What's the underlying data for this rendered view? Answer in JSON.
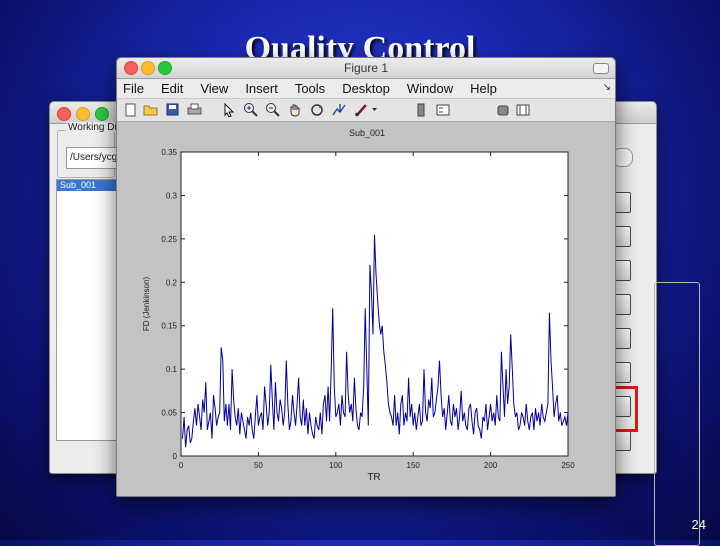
{
  "slide": {
    "title": "Quality Control",
    "page_number": "24"
  },
  "back_window": {
    "working_dir_label": "Working Di",
    "path_value": "/Users/ycg",
    "subjects": [
      "Sub_001"
    ],
    "right_buttons": 8
  },
  "figure": {
    "window_title": "Figure 1",
    "menu": [
      "File",
      "Edit",
      "View",
      "Insert",
      "Tools",
      "Desktop",
      "Window",
      "Help"
    ],
    "toolbar_icons": [
      "new-figure-icon",
      "open-file-icon",
      "save-icon",
      "print-icon",
      "pointer-icon",
      "zoom-in-icon",
      "zoom-out-icon",
      "pan-icon",
      "rotate-icon",
      "data-cursor-icon",
      "brush-icon",
      "colorbar-icon",
      "legend-icon",
      "plot-tools-icon"
    ]
  },
  "chart_data": {
    "type": "line",
    "title": "Sub_001",
    "xlabel": "TR",
    "ylabel": "FD (Jenkinson)",
    "xlim": [
      0,
      250
    ],
    "ylim": [
      0,
      0.35
    ],
    "xticks": [
      0,
      50,
      100,
      150,
      200,
      250
    ],
    "yticks": [
      0,
      0.05,
      0.1,
      0.15,
      0.2,
      0.25,
      0.3,
      0.35
    ],
    "color": "#0000a0",
    "series": [
      {
        "values": [
          0.02,
          0.045,
          0.01,
          0.03,
          0.035,
          0.015,
          0.02,
          0.04,
          0.055,
          0.035,
          0.06,
          0.045,
          0.03,
          0.065,
          0.05,
          0.085,
          0.03,
          0.04,
          0.05,
          0.02,
          0.07,
          0.055,
          0.035,
          0.045,
          0.05,
          0.125,
          0.11,
          0.04,
          0.06,
          0.035,
          0.06,
          0.03,
          0.1,
          0.065,
          0.045,
          0.035,
          0.055,
          0.025,
          0.05,
          0.04,
          0.03,
          0.02,
          0.045,
          0.035,
          0.05,
          0.03,
          0.02,
          0.045,
          0.07,
          0.035,
          0.045,
          0.05,
          0.03,
          0.08,
          0.06,
          0.035,
          0.05,
          0.105,
          0.065,
          0.03,
          0.085,
          0.05,
          0.04,
          0.065,
          0.055,
          0.035,
          0.05,
          0.11,
          0.06,
          0.03,
          0.04,
          0.07,
          0.05,
          0.035,
          0.06,
          0.09,
          0.045,
          0.035,
          0.065,
          0.035,
          0.055,
          0.025,
          0.05,
          0.035,
          0.025,
          0.02,
          0.045,
          0.035,
          0.03,
          0.05,
          0.025,
          0.06,
          0.07,
          0.04,
          0.08,
          0.04,
          0.1,
          0.17,
          0.08,
          0.045,
          0.05,
          0.06,
          0.035,
          0.07,
          0.05,
          0.045,
          0.12,
          0.07,
          0.05,
          0.06,
          0.04,
          0.09,
          0.055,
          0.035,
          0.03,
          0.05,
          0.045,
          0.08,
          0.17,
          0.1,
          0.035,
          0.22,
          0.19,
          0.14,
          0.255,
          0.21,
          0.18,
          0.155,
          0.14,
          0.15,
          0.12,
          0.105,
          0.085,
          0.06,
          0.05,
          0.045,
          0.035,
          0.07,
          0.035,
          0.05,
          0.025,
          0.06,
          0.07,
          0.035,
          0.05,
          0.04,
          0.09,
          0.045,
          0.06,
          0.035,
          0.05,
          0.03,
          0.045,
          0.06,
          0.035,
          0.04,
          0.1,
          0.05,
          0.04,
          0.065,
          0.055,
          0.09,
          0.045,
          0.05,
          0.065,
          0.08,
          0.11,
          0.07,
          0.045,
          0.055,
          0.03,
          0.05,
          0.07,
          0.04,
          0.035,
          0.06,
          0.045,
          0.055,
          0.03,
          0.045,
          0.075,
          0.04,
          0.05,
          0.035,
          0.03,
          0.055,
          0.06,
          0.04,
          0.025,
          0.05,
          0.055,
          0.035,
          0.03,
          0.02,
          0.045,
          0.04,
          0.06,
          0.03,
          0.045,
          0.06,
          0.04,
          0.05,
          0.035,
          0.07,
          0.045,
          0.04,
          0.12,
          0.08,
          0.045,
          0.1,
          0.06,
          0.08,
          0.14,
          0.1,
          0.06,
          0.045,
          0.05,
          0.03,
          0.035,
          0.05,
          0.045,
          0.035,
          0.06,
          0.04,
          0.03,
          0.045,
          0.05,
          0.03,
          0.055,
          0.04,
          0.05,
          0.035,
          0.06,
          0.045,
          0.04,
          0.05,
          0.06,
          0.165,
          0.11,
          0.08,
          0.045,
          0.06,
          0.07,
          0.04,
          0.05,
          0.035,
          0.04,
          0.045,
          0.035,
          0.05
        ]
      }
    ]
  }
}
